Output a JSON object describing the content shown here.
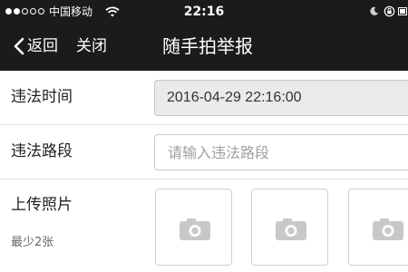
{
  "status_bar": {
    "carrier": "中国移动",
    "time": "22:16",
    "signal_bars_filled": 2,
    "signal_bars_total": 5
  },
  "nav": {
    "back_label": "返回",
    "close_label": "关闭",
    "title": "随手拍举报"
  },
  "form": {
    "time_label": "违法时间",
    "time_value": "2016-04-29 22:16:00",
    "road_label": "违法路段",
    "road_placeholder": "请输入违法路段",
    "road_value": "",
    "photo_label": "上传照片",
    "photo_hint": "最少2张"
  },
  "colors": {
    "header_bg": "#1b1b1b",
    "header_text": "#ffffff",
    "disabled_field_bg": "#eaeaea",
    "border": "#c9c9c9",
    "camera_icon": "#c8c8c8"
  },
  "icons": [
    "signal-icon",
    "wifi-icon",
    "moon-icon",
    "rotation-lock-icon",
    "battery-icon",
    "back-chevron-icon",
    "camera-icon"
  ]
}
